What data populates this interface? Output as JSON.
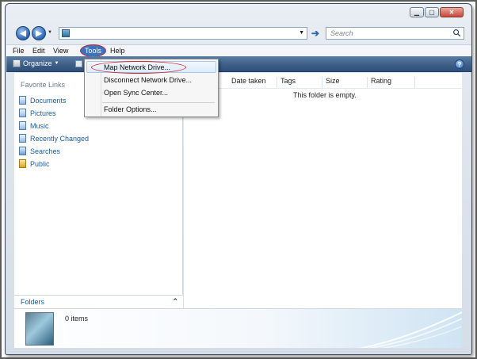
{
  "search": {
    "placeholder": "Search"
  },
  "menu": {
    "file": "File",
    "edit": "Edit",
    "view": "View",
    "tools": "Tools",
    "help": "Help"
  },
  "toolbar": {
    "organize": "Organize"
  },
  "tools_menu": {
    "items": [
      "Map Network Drive...",
      "Disconnect Network Drive...",
      "Open Sync Center...",
      "Folder Options..."
    ],
    "highlighted": "Map Network Drive..."
  },
  "nav": {
    "section_title": "Favorite Links",
    "items": [
      "Documents",
      "Pictures",
      "Music",
      "Recently Changed",
      "Searches",
      "Public"
    ],
    "folders_label": "Folders"
  },
  "columns": [
    "Date taken",
    "Tags",
    "Size",
    "Rating"
  ],
  "content": {
    "empty_message": "This folder is empty."
  },
  "details": {
    "item_count": "0 items"
  },
  "colors": {
    "highlight_circle": "#d0242a",
    "link_blue": "#1a5fa0",
    "toolbar_blue": "#3d5f88"
  }
}
